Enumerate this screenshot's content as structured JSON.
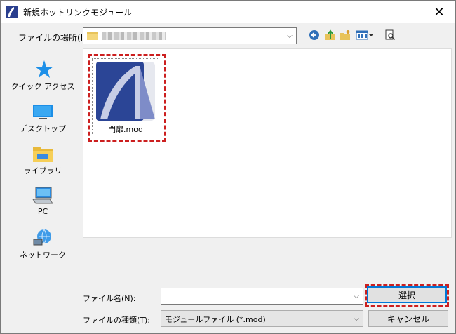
{
  "window": {
    "title": "新規ホットリンクモジュール",
    "close_glyph": "✕"
  },
  "location": {
    "label": "ファイルの場所(I):",
    "value": "",
    "arrow_glyph": "⌵"
  },
  "toolbar": {
    "icons": [
      "back-icon",
      "up-folder-icon",
      "new-folder-icon",
      "view-menu-icon",
      "preview-icon"
    ]
  },
  "sidebar": {
    "items": [
      {
        "label": "クイック アクセス",
        "icon": "star-icon"
      },
      {
        "label": "デスクトップ",
        "icon": "desktop-icon"
      },
      {
        "label": "ライブラリ",
        "icon": "library-icon"
      },
      {
        "label": "PC",
        "icon": "pc-icon"
      },
      {
        "label": "ネットワーク",
        "icon": "network-icon"
      }
    ]
  },
  "files": [
    {
      "name": "門扉.mod",
      "icon": "archicad-module-icon"
    }
  ],
  "filename": {
    "label": "ファイル名(N):",
    "value": ""
  },
  "filetype": {
    "label": "ファイルの種類(T):",
    "selected": "モジュールファイル (*.mod)"
  },
  "buttons": {
    "select": "選択",
    "cancel": "キャンセル"
  },
  "colors": {
    "highlight": "#cc1f1f",
    "focus_border": "#0078d7"
  }
}
